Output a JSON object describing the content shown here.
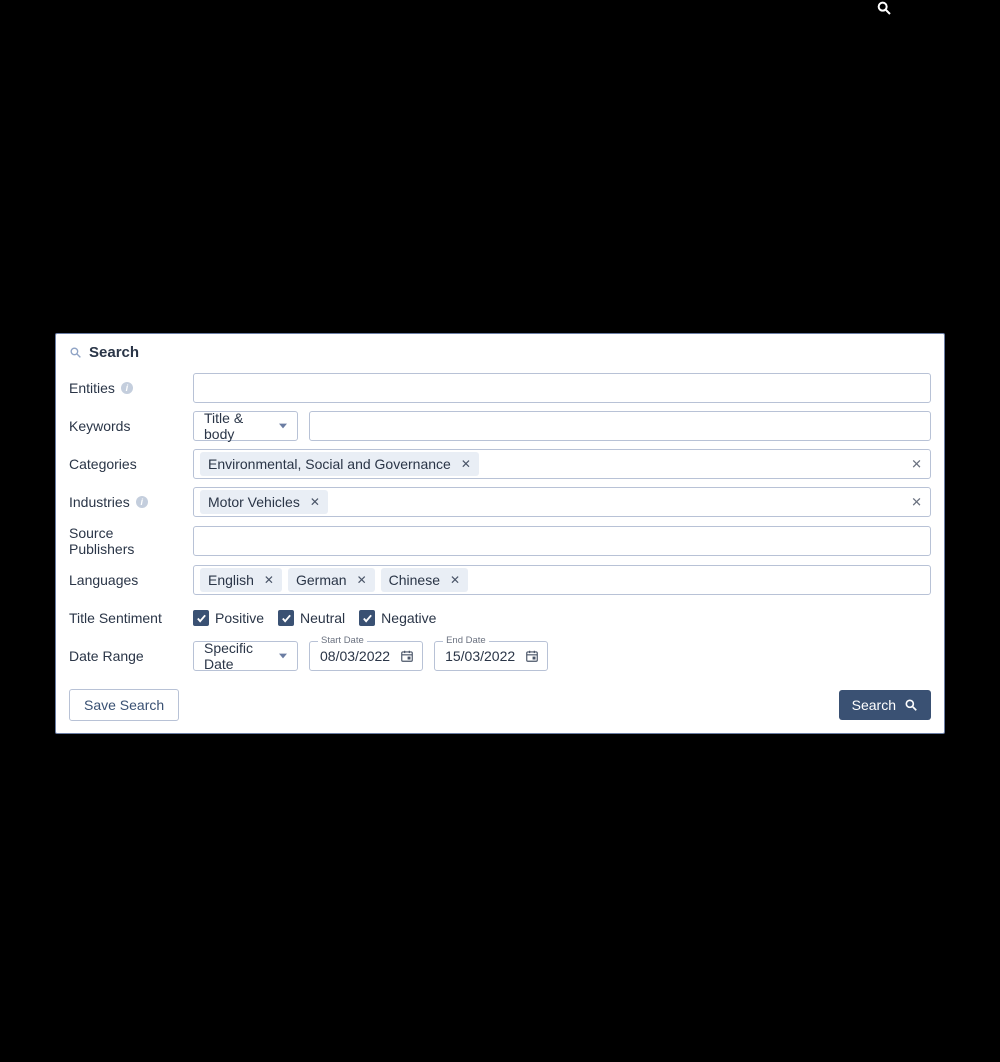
{
  "header": {
    "title": "Search"
  },
  "labels": {
    "entities": "Entities",
    "keywords": "Keywords",
    "categories": "Categories",
    "industries": "Industries",
    "source_publishers": "Source Publishers",
    "languages": "Languages",
    "title_sentiment": "Title Sentiment",
    "date_range": "Date Range"
  },
  "keywords": {
    "scope_selected": "Title & body",
    "value": ""
  },
  "entities": {
    "value": ""
  },
  "categories": {
    "chips": [
      "Environmental, Social and Governance"
    ]
  },
  "industries": {
    "chips": [
      "Motor Vehicles"
    ]
  },
  "source_publishers": {
    "value": ""
  },
  "languages": {
    "chips": [
      "English",
      "German",
      "Chinese"
    ]
  },
  "sentiment": {
    "positive": {
      "label": "Positive",
      "checked": true
    },
    "neutral": {
      "label": "Neutral",
      "checked": true
    },
    "negative": {
      "label": "Negative",
      "checked": true
    }
  },
  "date_range": {
    "mode_selected": "Specific Date",
    "start_label": "Start Date",
    "start_value": "08/03/2022",
    "end_label": "End Date",
    "end_value": "15/03/2022"
  },
  "buttons": {
    "save_search": "Save Search",
    "search": "Search"
  }
}
